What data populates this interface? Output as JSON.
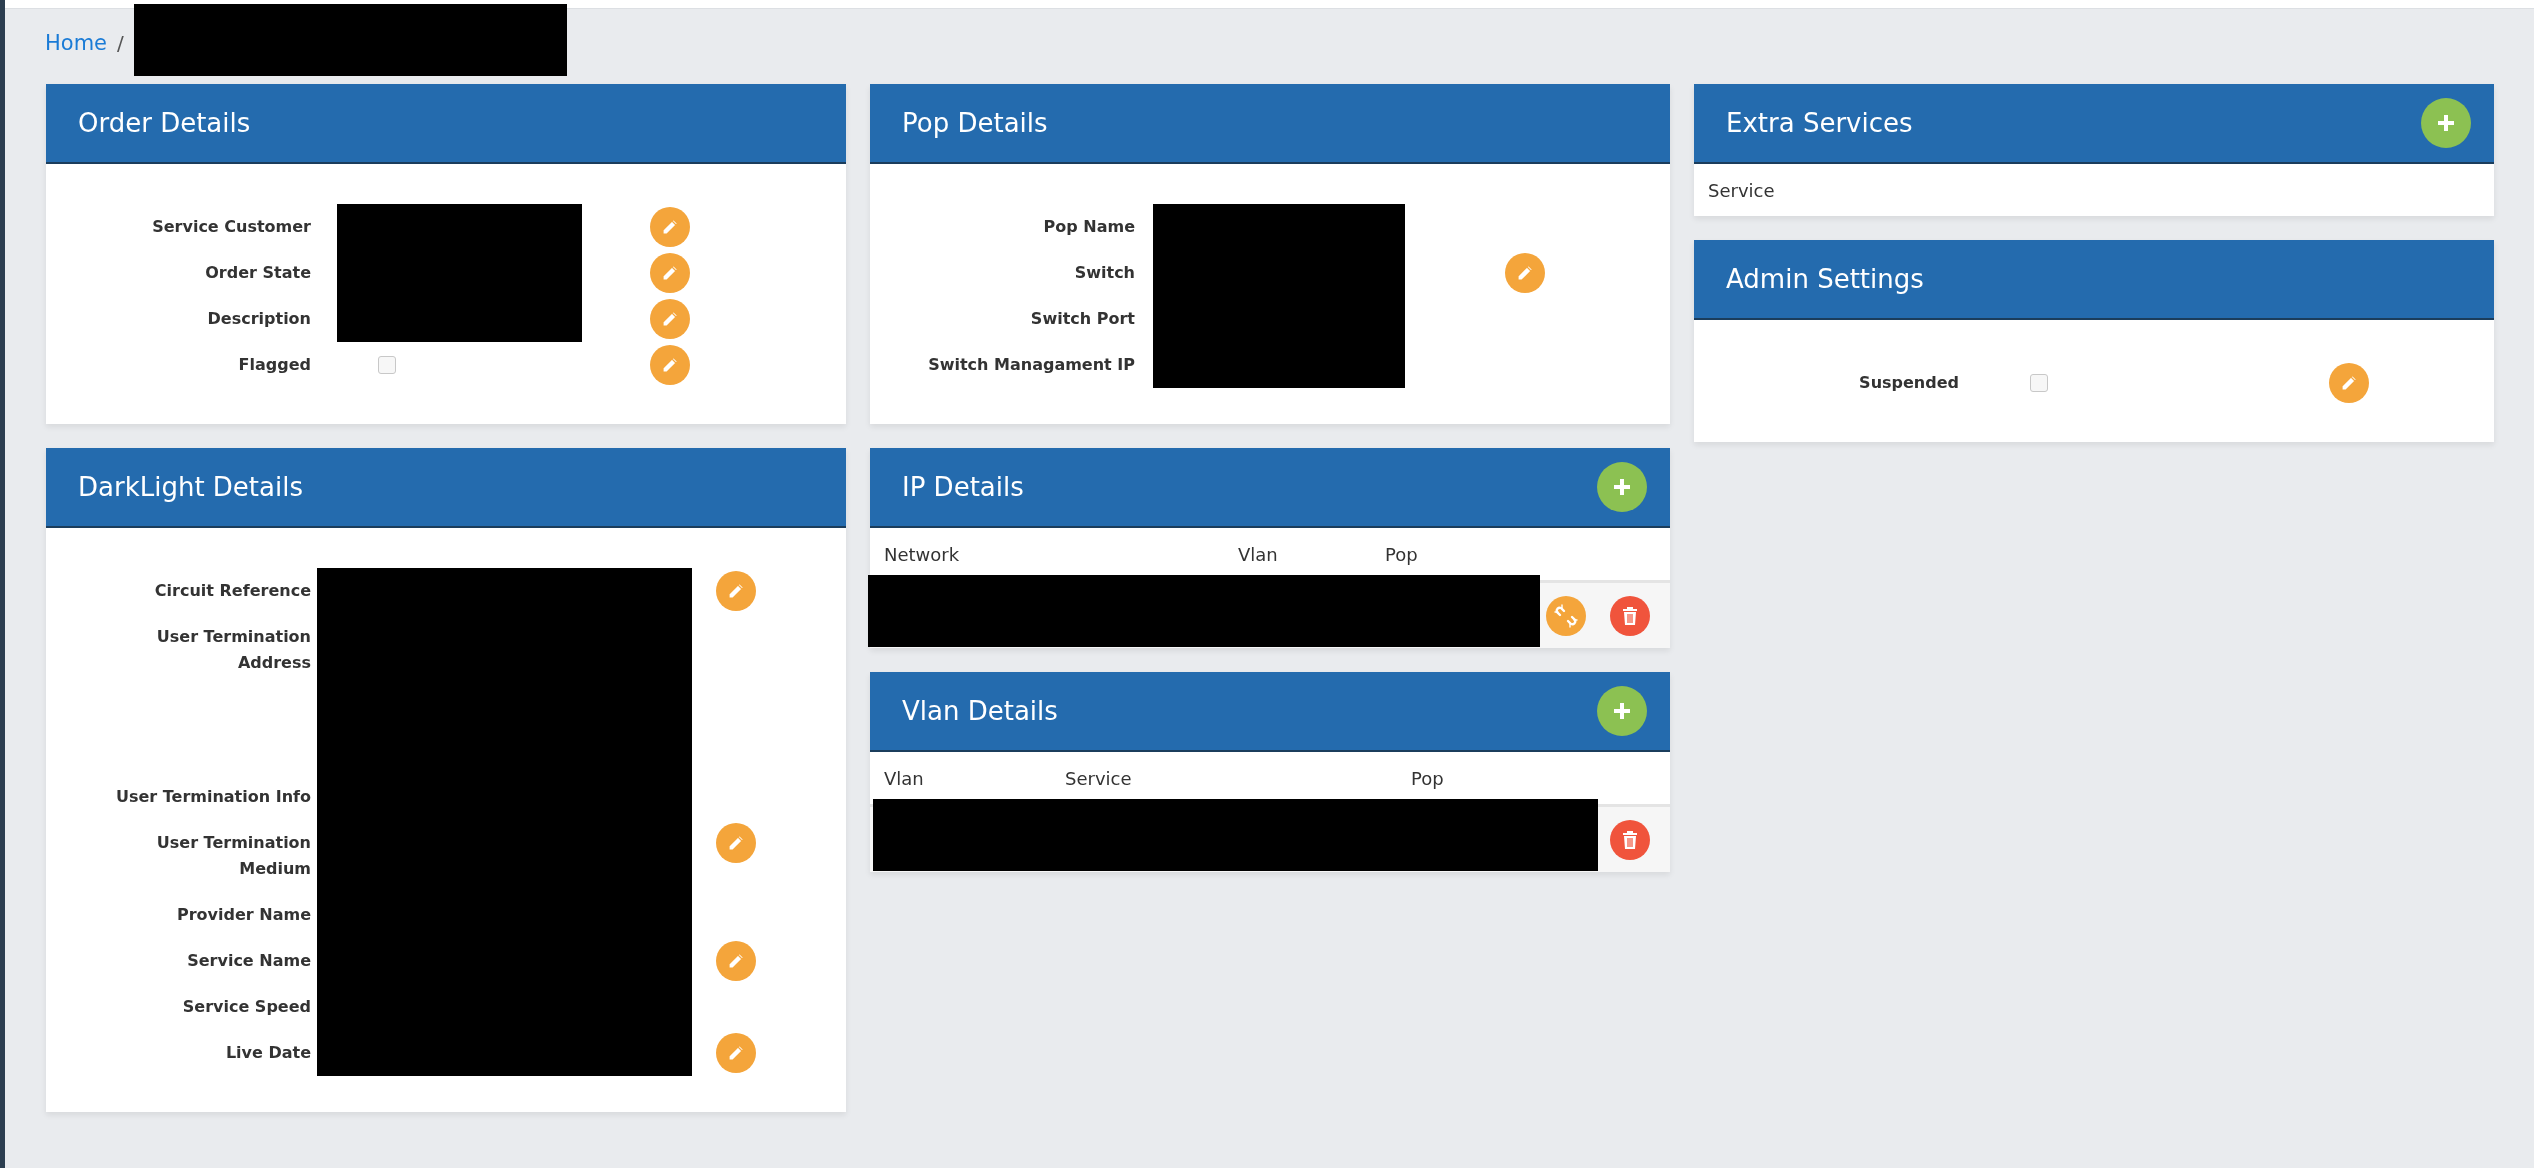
{
  "breadcrumb": {
    "home": "Home",
    "separator": "/",
    "current_redacted": true
  },
  "order_details": {
    "title": "Order Details",
    "fields": [
      {
        "label": "Service Customer",
        "kind": "text",
        "redacted": true,
        "editable": true
      },
      {
        "label": "Order State",
        "kind": "text",
        "redacted": true,
        "editable": true
      },
      {
        "label": "Description",
        "kind": "text",
        "redacted": true,
        "editable": true
      },
      {
        "label": "Flagged",
        "kind": "checkbox",
        "checked": false,
        "editable": true
      }
    ]
  },
  "darklight_details": {
    "title": "DarkLight Details",
    "fields": [
      {
        "label": "Circuit Reference",
        "kind": "text",
        "redacted": true,
        "editable": true
      },
      {
        "label": "User Termination Address",
        "kind": "textarea",
        "redacted": true,
        "editable": false
      },
      {
        "label": "User Termination Info",
        "kind": "text",
        "redacted": true,
        "editable": false
      },
      {
        "label": "User Termination Medium",
        "kind": "text",
        "redacted": true,
        "editable": true
      },
      {
        "label": "Provider Name",
        "kind": "text",
        "redacted": true,
        "editable": false
      },
      {
        "label": "Service Name",
        "kind": "text",
        "redacted": true,
        "editable": true
      },
      {
        "label": "Service Speed",
        "kind": "text",
        "redacted": true,
        "editable": false
      },
      {
        "label": "Live Date",
        "kind": "text",
        "redacted": true,
        "editable": true
      }
    ]
  },
  "pop_details": {
    "title": "Pop Details",
    "fields": [
      {
        "label": "Pop Name",
        "kind": "text",
        "redacted": true,
        "editable": false
      },
      {
        "label": "Switch",
        "kind": "text",
        "redacted": true,
        "editable": true
      },
      {
        "label": "Switch Port",
        "kind": "text",
        "redacted": true,
        "editable": false
      },
      {
        "label": "Switch Managament IP",
        "kind": "text",
        "redacted": true,
        "editable": false
      }
    ]
  },
  "ip_details": {
    "title": "IP Details",
    "add_button": true,
    "columns": [
      "Network",
      "Vlan",
      "Pop"
    ],
    "rows": [
      {
        "redacted": true,
        "actions": [
          {
            "kind": "unlink"
          },
          {
            "kind": "delete"
          }
        ]
      }
    ]
  },
  "vlan_details": {
    "title": "Vlan Details",
    "add_button": true,
    "columns": [
      "Vlan",
      "Service",
      "Pop"
    ],
    "rows": [
      {
        "redacted": true,
        "actions": [
          {
            "kind": "delete"
          }
        ]
      }
    ]
  },
  "extra_services": {
    "title": "Extra Services",
    "add_button": true,
    "columns": [
      "Service"
    ]
  },
  "admin_settings": {
    "title": "Admin Settings",
    "fields": [
      {
        "label": "Suspended",
        "kind": "checkbox",
        "checked": false,
        "editable": true
      }
    ]
  }
}
